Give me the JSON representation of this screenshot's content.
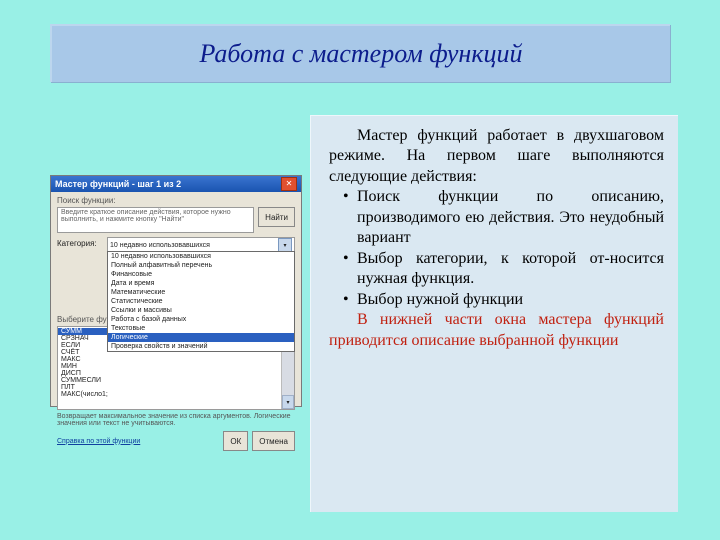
{
  "slide": {
    "title": "Работа с мастером функций",
    "para1": "Мастер функций работает в двухшаговом режиме. На первом шаге выполняются следующие действия:",
    "b1": "Поиск функции по описанию, производимого ею действия. Это неудобный вариант",
    "b2": " Выбор категории, к которой от-носится нужная функция.",
    "b3": "Выбор нужной функции",
    "note": "В нижней части окна мастера функций приводится описание выбранной функции"
  },
  "dialog": {
    "title": "Мастер функций - шаг 1 из 2",
    "close": "✕",
    "search_label": "Поиск функции:",
    "search_hint": "Введите краткое описание действия, которое нужно выполнить, и нажмите кнопку \"Найти\"",
    "find_btn": "Найти",
    "cat_label": "Категория:",
    "cat_value": "10 недавно использовавшихся",
    "categories": [
      "10 недавно использовавшихся",
      "Полный алфавитный перечень",
      "Финансовые",
      "Дата и время",
      "Математические",
      "Статистические",
      "Ссылки и массивы",
      "Работа с базой данных",
      "Текстовые",
      "Логические",
      "Проверка свойств и значений"
    ],
    "func_label": "Выберите функцию:",
    "funcs": [
      "СУММ",
      "СРЗНАЧ",
      "ЕСЛИ",
      "СЧЁТ",
      "МАКС",
      "МИН",
      "ДИСП",
      "СУММЕСЛИ",
      "ПЛТ",
      "МАКС(число1;"
    ],
    "desc": "Возвращает максимальное значение из списка аргументов. Логические значения или текст не учитываются.",
    "help": "Справка по этой функции",
    "ok": "ОК",
    "cancel": "Отмена"
  }
}
